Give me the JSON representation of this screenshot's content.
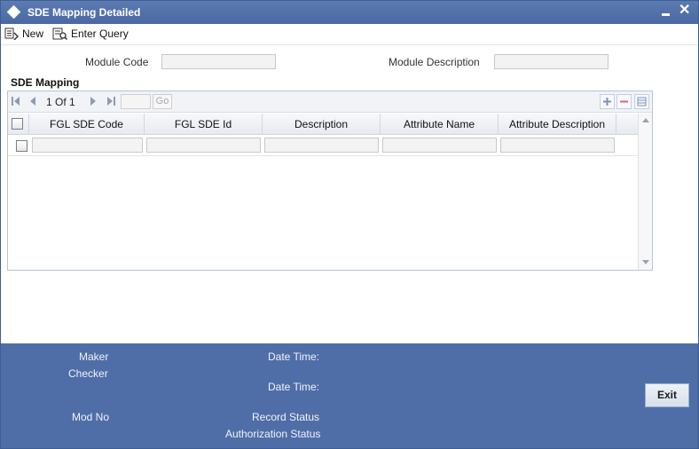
{
  "window": {
    "title": "SDE Mapping Detailed"
  },
  "toolbar": {
    "new_label": "New",
    "enter_query_label": "Enter Query"
  },
  "fields": {
    "module_code_label": "Module Code",
    "module_code_value": "",
    "module_description_label": "Module Description",
    "module_description_value": ""
  },
  "section": {
    "title": "SDE Mapping"
  },
  "pager": {
    "text": "1 Of 1",
    "page_input": "",
    "go_label": "Go"
  },
  "grid": {
    "columns": [
      "FGL SDE Code",
      "FGL SDE Id",
      "Description",
      "Attribute Name",
      "Attribute Description"
    ],
    "rows": [
      [
        "",
        "",
        "",
        "",
        ""
      ]
    ]
  },
  "footer": {
    "maker_label": "Maker",
    "checker_label": "Checker",
    "date_time_label_1": "Date Time:",
    "date_time_label_2": "Date Time:",
    "mod_no_label": "Mod No",
    "record_status_label": "Record Status",
    "authorization_status_label": "Authorization Status",
    "exit_label": "Exit"
  },
  "colors": {
    "title_bar": "#4a68a2",
    "footer": "#4f6ea8",
    "accent": "#3f5e94"
  }
}
